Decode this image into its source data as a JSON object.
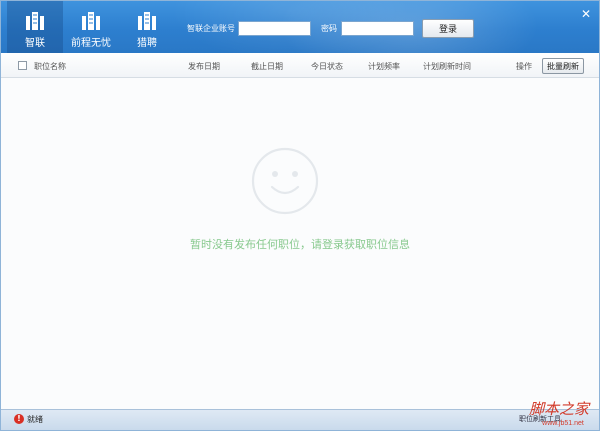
{
  "tabs": [
    {
      "label": "智联",
      "active": true,
      "icon": "buildings-icon"
    },
    {
      "label": "前程无忧",
      "active": false,
      "icon": "buildings-icon"
    },
    {
      "label": "猎聘",
      "active": false,
      "icon": "buildings-icon"
    }
  ],
  "login": {
    "account_label": "智联企业账号",
    "account_value": "",
    "password_label": "密码",
    "password_value": "",
    "login_button": "登录"
  },
  "close_label": "✕",
  "columns": {
    "job_name": "职位名称",
    "publish_date": "发布日期",
    "end_date": "截止日期",
    "today_status": "今日状态",
    "refresh_frequency": "计划频率",
    "refresh_time": "计划刷新时间",
    "action": "操作",
    "batch_refresh": "批量刷新"
  },
  "empty_state": {
    "icon": "smiley-face-icon",
    "message": "暂时没有发布任何职位，请登录获取职位信息"
  },
  "status": {
    "icon": "error-icon",
    "text": "就绪",
    "right_text": "职位刷新工具"
  },
  "watermark": {
    "text": "脚本之家",
    "sub": "www.jb51.net"
  },
  "colors": {
    "header": "#2d7fcf",
    "empty_text": "#88c98e",
    "status_bar": "#c9daec",
    "error": "#d93025"
  }
}
